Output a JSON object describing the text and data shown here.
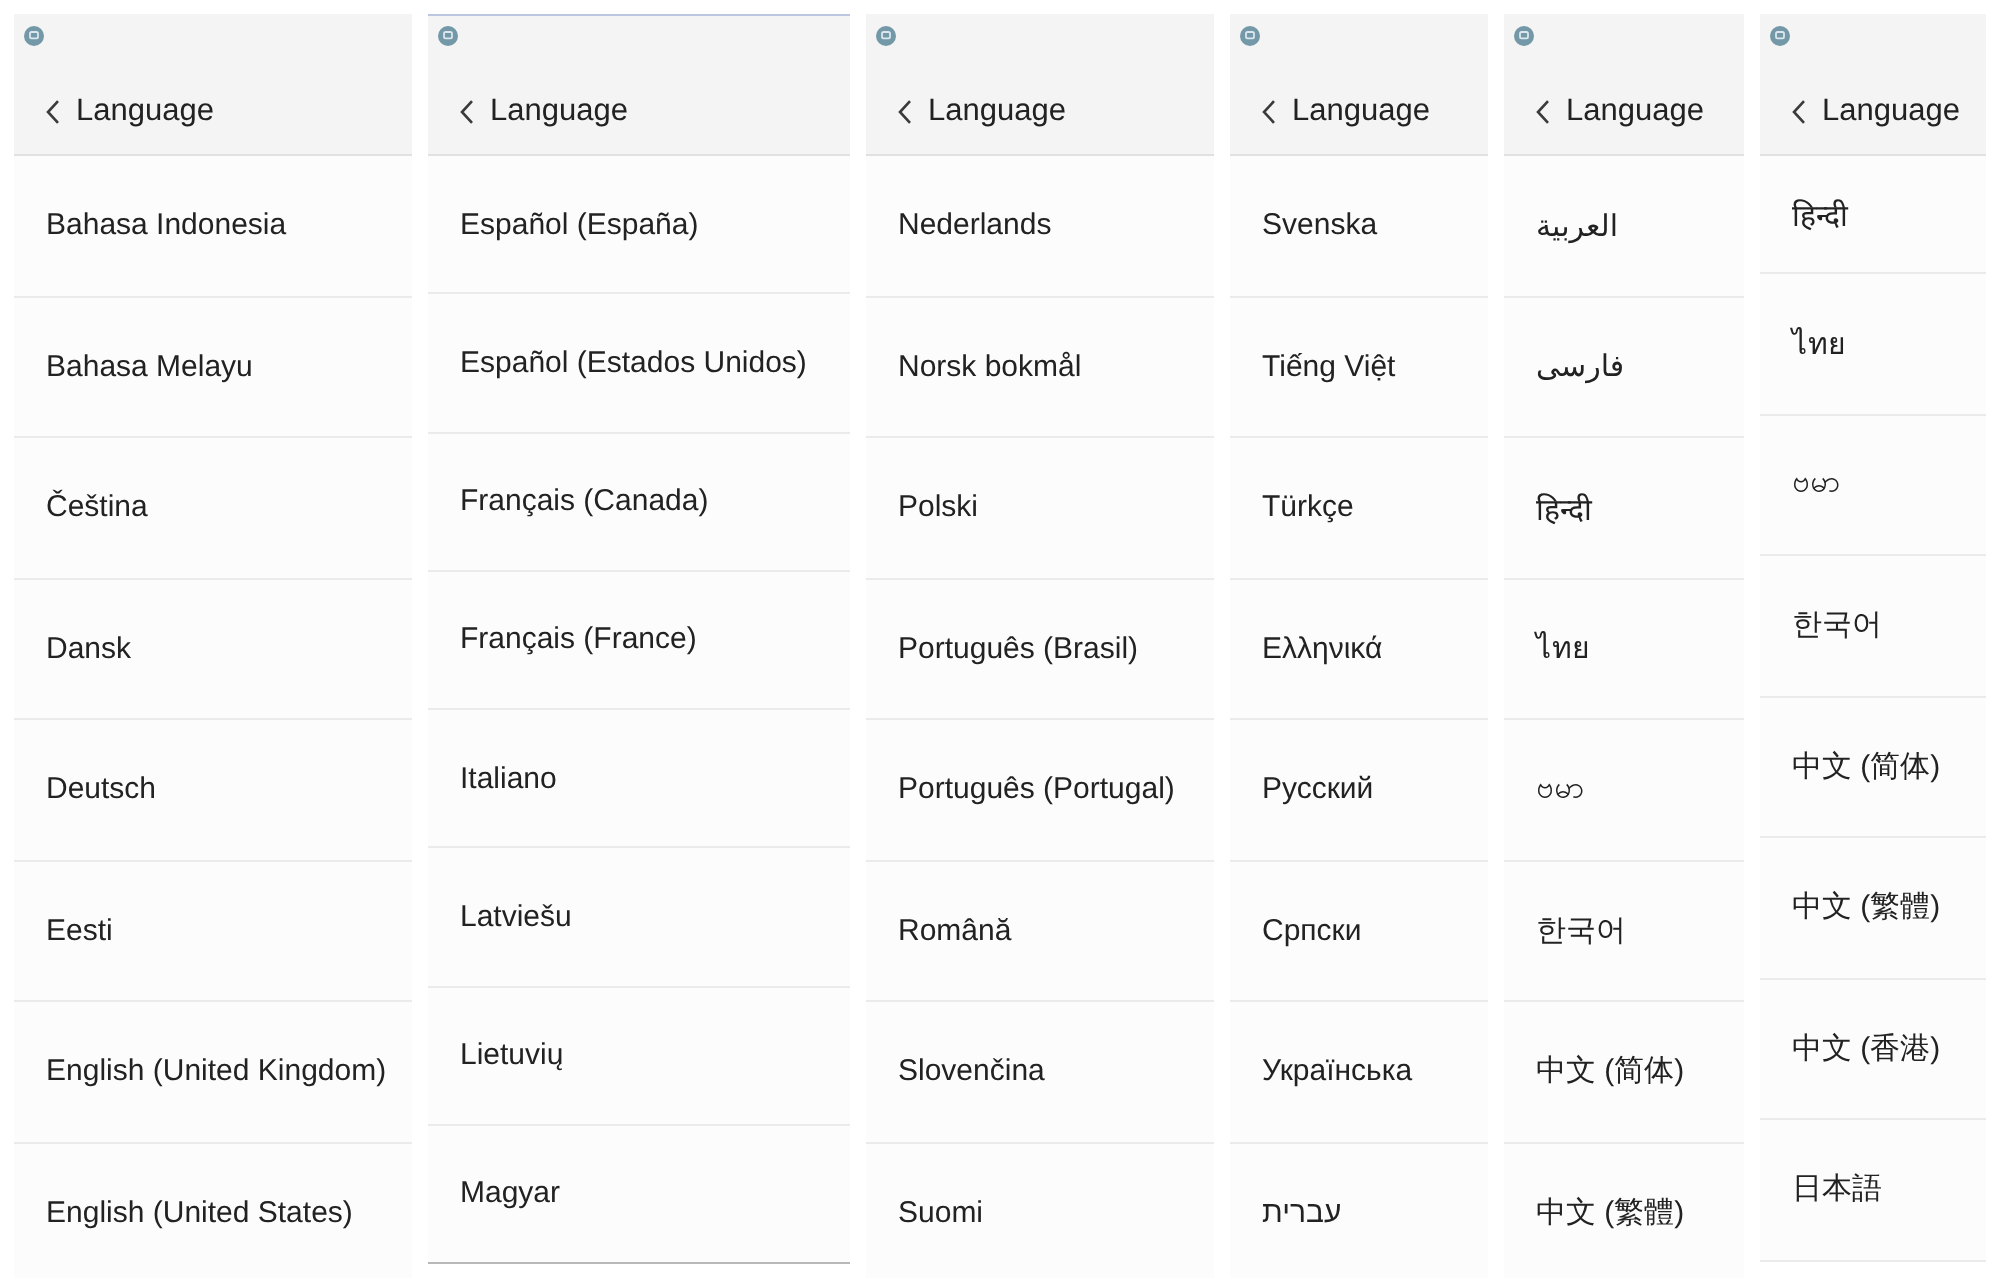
{
  "screens": [
    {
      "title": "Language",
      "items": [
        "Bahasa Indonesia",
        "Bahasa Melayu",
        "Čeština",
        "Dansk",
        "Deutsch",
        "Eesti",
        "English (United Kingdom)",
        "English (United States)"
      ]
    },
    {
      "title": "Language",
      "items": [
        "Español (España)",
        "Español (Estados Unidos)",
        "Français (Canada)",
        "Français (France)",
        "Italiano",
        "Latviešu",
        "Lietuvių",
        "Magyar"
      ]
    },
    {
      "title": "Language",
      "items": [
        "Nederlands",
        "Norsk bokmål",
        "Polski",
        "Português (Brasil)",
        "Português (Portugal)",
        "Română",
        "Slovenčina",
        "Suomi"
      ]
    },
    {
      "title": "Language",
      "items": [
        "Svenska",
        "Tiếng Việt",
        "Türkçe",
        "Ελληνικά",
        "Русский",
        "Српски",
        "Українська",
        "עברית"
      ]
    },
    {
      "title": "Language",
      "items": [
        "العربية",
        "فارسی",
        "हिन्दी",
        "ไทย",
        "ဗမာ",
        "한국어",
        "中文 (简体)",
        "中文 (繁體)"
      ]
    },
    {
      "title": "Language",
      "items": [
        "हिन्दी",
        "ไทย",
        "ဗမာ",
        "한국어",
        "中文 (简体)",
        "中文 (繁體)",
        "中文 (香港)",
        "日本語"
      ]
    }
  ]
}
